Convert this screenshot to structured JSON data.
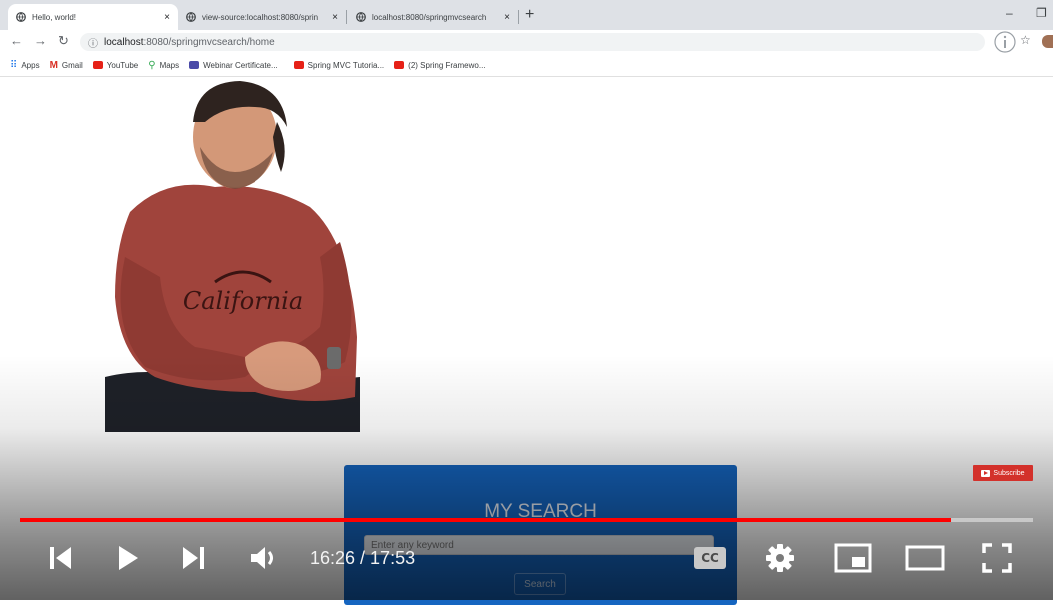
{
  "browser": {
    "tabs": [
      {
        "title": "Hello, world!",
        "close": "×"
      },
      {
        "title": "view-source:localhost:8080/sprin",
        "close": "×"
      },
      {
        "title": "localhost:8080/springmvcsearch",
        "close": "×"
      }
    ],
    "new_tab": "+",
    "minimize": "–",
    "maximize": "❐",
    "url_host": "localhost",
    "url_path": ":8080/springmvcsearch/home",
    "bookmarks": [
      {
        "label": "Apps",
        "icon": "apps-grid-icon"
      },
      {
        "label": "Gmail",
        "icon": "gmail-icon"
      },
      {
        "label": "YouTube",
        "icon": "youtube-icon"
      },
      {
        "label": "Maps",
        "icon": "maps-pin-icon"
      },
      {
        "label": "Webinar Certificate...",
        "icon": "forms-icon"
      },
      {
        "label": "Spring MVC Tutoria...",
        "icon": "youtube-icon"
      },
      {
        "label": "(2) Spring Framewo...",
        "icon": "youtube-icon"
      }
    ]
  },
  "page": {
    "search_title": "MY SEARCH",
    "search_placeholder": "Enter any keyword",
    "search_button": "Search"
  },
  "player": {
    "subscribe_label": "Subscribe",
    "current_time": "16:26",
    "duration": "17:53",
    "time_display": "16:26 / 17:53",
    "played_fraction": 0.919,
    "cc_label": "CC",
    "accent": "#ff0000"
  }
}
